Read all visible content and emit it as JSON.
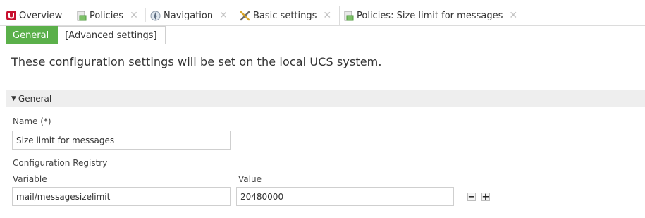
{
  "tabs": [
    {
      "label": "Overview",
      "icon": "ucs-logo-icon",
      "closable": false
    },
    {
      "label": "Policies",
      "icon": "policy-icon",
      "closable": true
    },
    {
      "label": "Navigation",
      "icon": "navigation-icon",
      "closable": true
    },
    {
      "label": "Basic settings",
      "icon": "tools-icon",
      "closable": true
    },
    {
      "label": "Policies: Size limit for messages",
      "icon": "policy-icon",
      "closable": true,
      "active": true
    }
  ],
  "close_glyph": "✕",
  "subtabs": [
    {
      "label": "General",
      "active": true
    },
    {
      "label": "[Advanced settings]",
      "active": false
    }
  ],
  "headline": "These configuration settings will be set on the local UCS system.",
  "section": {
    "title": "General",
    "expanded": true
  },
  "form": {
    "name_label": "Name (*)",
    "name_value": "Size limit for messages",
    "registry_label": "Configuration Registry",
    "variable_label": "Variable",
    "value_label": "Value",
    "variable_value": "mail/messagesizelimit",
    "value_value": "20480000",
    "remove_glyph": "−",
    "add_glyph": "+"
  },
  "colors": {
    "accent": "#5bb04a",
    "logo": "#c8102e"
  }
}
